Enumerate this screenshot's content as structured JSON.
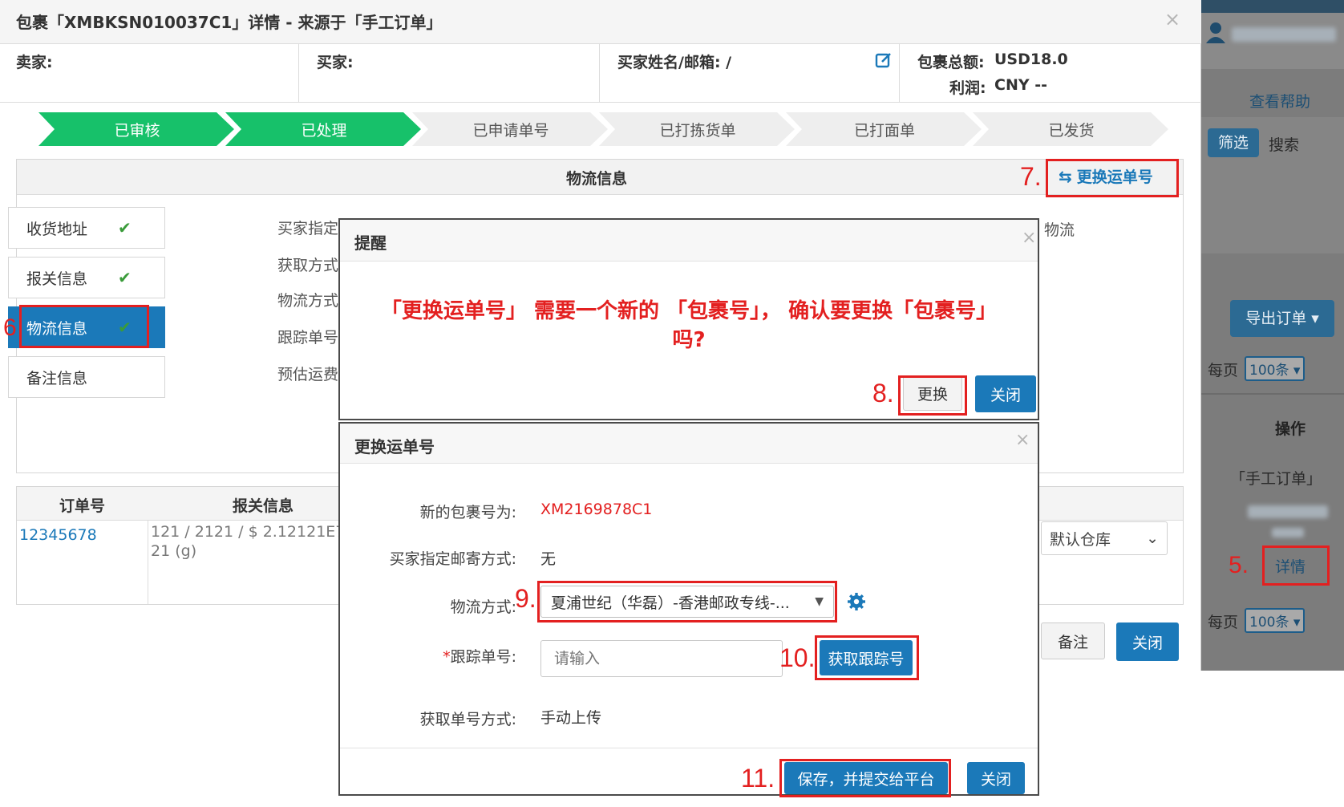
{
  "modal": {
    "title": "包裹「XMBKSN010037C1」详情 - 来源于「手工订单」",
    "close": "×",
    "info": {
      "seller_label": "卖家:",
      "buyer_label": "买家:",
      "buyer_name_label": "买家姓名/邮箱: /",
      "total_label": "包裹总额:",
      "total_value": "USD18.0",
      "profit_label": "利润:",
      "profit_value": "CNY --"
    },
    "steps": [
      {
        "label": "已审核",
        "done": true
      },
      {
        "label": "已处理",
        "done": true
      },
      {
        "label": "已申请单号",
        "done": false
      },
      {
        "label": "已打拣货单",
        "done": false
      },
      {
        "label": "已打面单",
        "done": false
      },
      {
        "label": "已发货",
        "done": false
      }
    ],
    "logistics_section_title": "物流信息",
    "change_tracking_btn": "更换运单号",
    "side_tabs": [
      {
        "label": "收货地址",
        "check": "✔",
        "active": false
      },
      {
        "label": "报关信息",
        "check": "✔",
        "active": false
      },
      {
        "label": "物流信息",
        "check": "✔",
        "active": true
      },
      {
        "label": "备注信息",
        "check": "",
        "active": false
      }
    ],
    "field_labels": [
      "买家指定",
      "获取方式",
      "物流方式",
      "跟踪单号",
      "预估运费"
    ],
    "right_fragment": "物流",
    "table": {
      "headers": [
        "订单号",
        "报关信息"
      ],
      "order_no": "12345678",
      "customs_line1": "121 / 2121 / $ 2.12121E7 /",
      "customs_line2": "21 (g)",
      "warehouse": "默认仓库"
    },
    "footer_note_btn": "备注",
    "footer_close_btn": "关闭"
  },
  "annotations": {
    "step5": "5.",
    "step6": "6",
    "step7": "7.",
    "step8": "8.",
    "step9": "9.",
    "step10": "10.",
    "step11": "11."
  },
  "reminder_dialog": {
    "title": "提醒",
    "close": "×",
    "message_line1": "「更换运单号」 需要一个新的 「包裹号」， 确认要更换「包裹号」",
    "message_line2": "吗?",
    "confirm_btn": "更换",
    "close_btn": "关闭"
  },
  "change_dialog": {
    "title": "更换运单号",
    "close": "×",
    "new_package_label": "新的包裹号为:",
    "new_package_value": "XM2169878C1",
    "buyer_method_label": "买家指定邮寄方式:",
    "buyer_method_value": "无",
    "logistics_label": "物流方式:",
    "logistics_value": "夏浦世纪（华磊）-香港邮政专线-...",
    "tracking_label": "跟踪单号:",
    "tracking_required": "*",
    "tracking_placeholder": "请输入",
    "get_tracking_btn": "获取跟踪号",
    "fetch_method_label": "获取单号方式:",
    "fetch_method_value": "手动上传",
    "save_btn": "保存，并提交给平台",
    "close_btn": "关闭"
  },
  "background_panel": {
    "help": "查看帮助",
    "filter": "筛选",
    "search": "搜索",
    "export": "导出订单 ▾",
    "per_page": "每页",
    "per_page_value": "100条 ▾",
    "operation": "操作",
    "source": "「手工订单」",
    "detail": "详情"
  },
  "colors": {
    "accent_blue": "#1b79b9",
    "step_green": "#17c16a",
    "annotation_red": "#e32020"
  }
}
